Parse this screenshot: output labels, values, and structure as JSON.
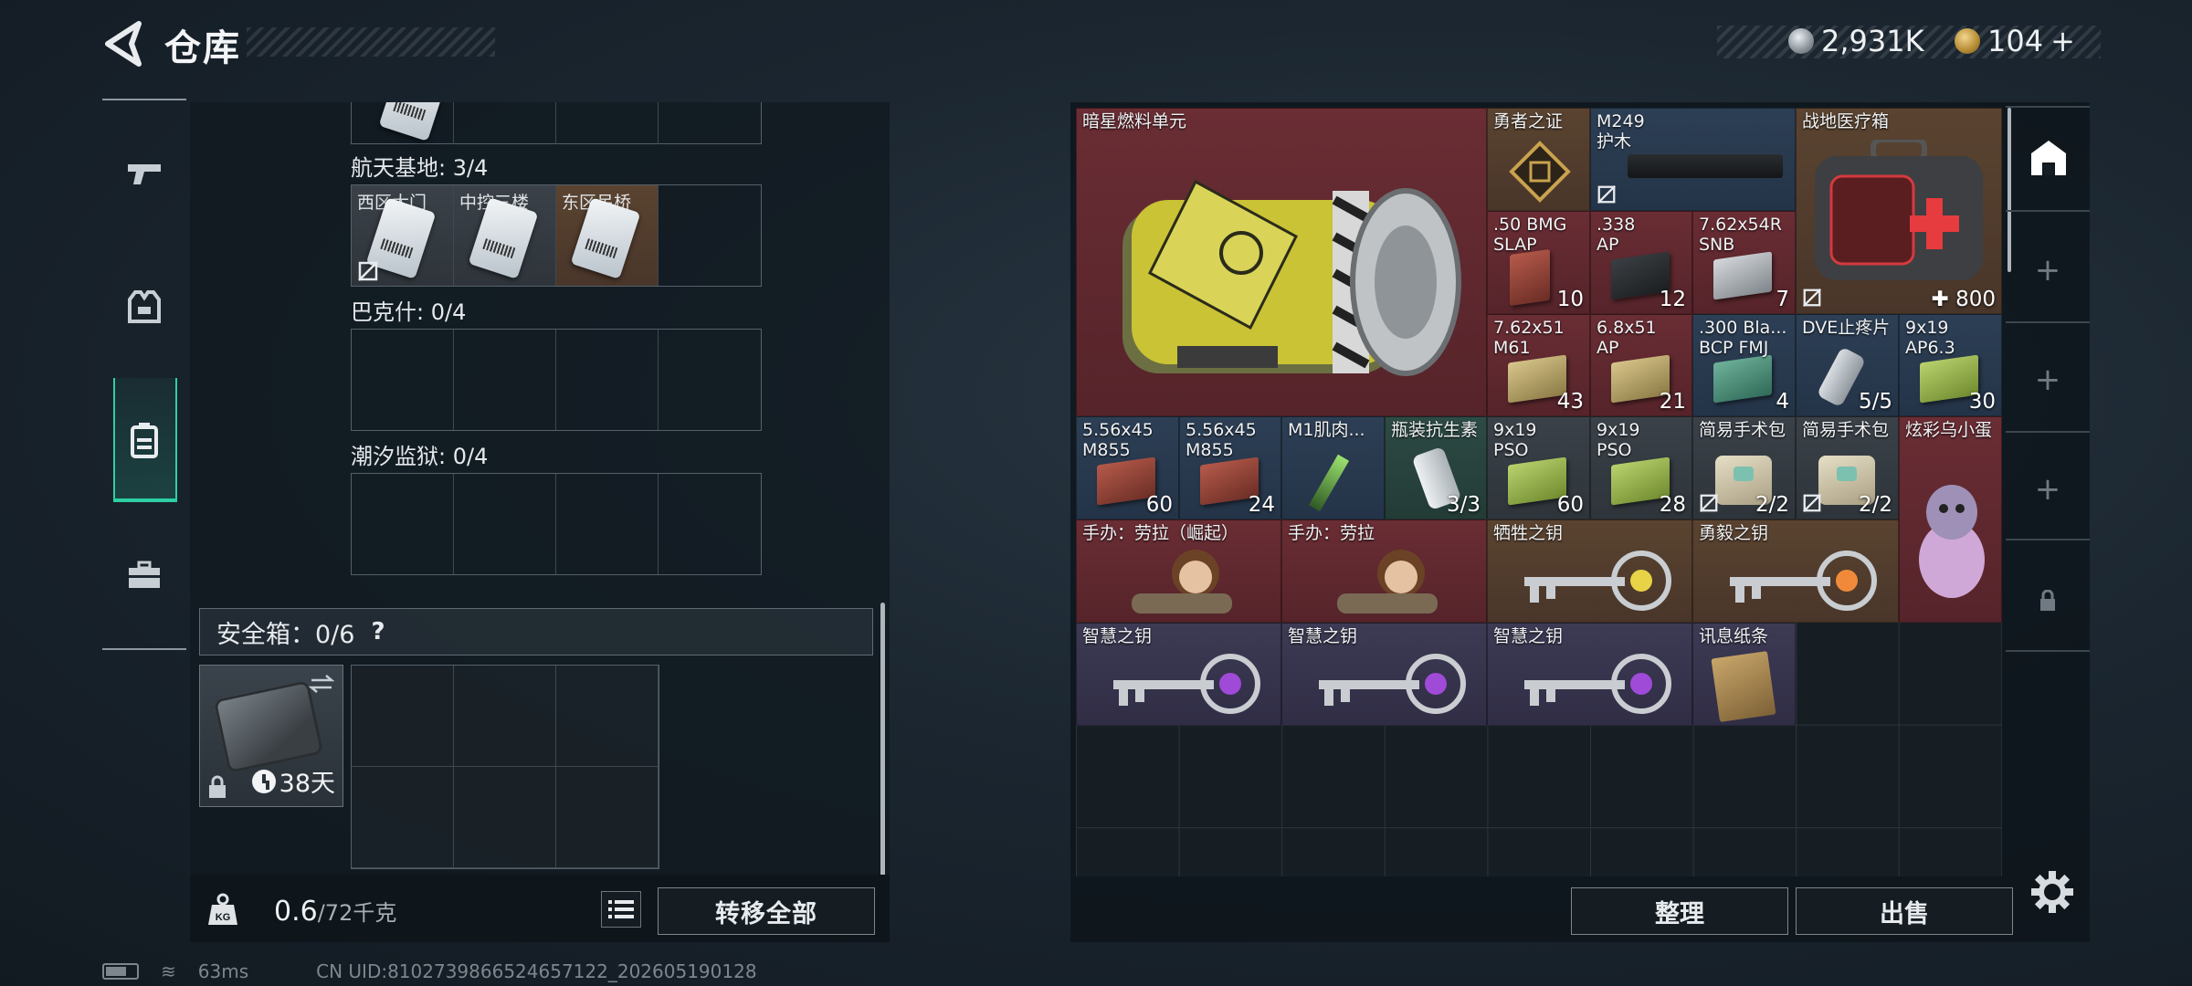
{
  "header": {
    "title": "仓库"
  },
  "currency": [
    {
      "icon": "silver-coin-icon",
      "value": "2,931K"
    },
    {
      "icon": "gold-coin-icon",
      "value": "104",
      "add": "+"
    }
  ],
  "left_nav": [
    {
      "icon": "pistol-icon"
    },
    {
      "icon": "armor-vest-icon"
    },
    {
      "icon": "backpack-icon",
      "active": true
    },
    {
      "icon": "toolbox-icon"
    }
  ],
  "key_sections": [
    {
      "label": "航天基地: 3/4",
      "slots": [
        "西区大门",
        "中控三楼",
        "东区吊桥",
        ""
      ]
    },
    {
      "label": "巴克什: 0/4"
    },
    {
      "label": "潮汐监狱: 0/4"
    }
  ],
  "safebox": {
    "label": "安全箱：0/6",
    "help": "?",
    "days": "38天"
  },
  "weight": {
    "current": "0.6",
    "max": "/72千克"
  },
  "buttons": {
    "transfer_all": "转移全部",
    "sort": "整理",
    "sell": "出售"
  },
  "status": {
    "ping": "63ms",
    "uid": "CN UID:8102739866524657122_202605190128"
  },
  "stash_items": [
    {
      "name": "暗星燃料单元"
    },
    {
      "name": "勇者之证"
    },
    {
      "name": "M249\n护木"
    },
    {
      "name": "战地医疗箱",
      "count": "✚ 800"
    },
    {
      "name": ".50 BMG\nSLAP",
      "count": "10"
    },
    {
      "name": ".338\nAP",
      "count": "12"
    },
    {
      "name": "7.62x54R\nSNB",
      "count": "7"
    },
    {
      "name": "7.62x51\nM61",
      "count": "43"
    },
    {
      "name": "6.8x51\nAP",
      "count": "21"
    },
    {
      "name": ".300 Bla...\nBCP FMJ",
      "count": "4"
    },
    {
      "name": "DVE止疼片",
      "count": "5/5"
    },
    {
      "name": "9x19\nAP6.3",
      "count": "30"
    },
    {
      "name": "5.56x45\nM855",
      "count": "60"
    },
    {
      "name": "5.56x45\nM855",
      "count": "24"
    },
    {
      "name": "M1肌肉..."
    },
    {
      "name": "瓶装抗生素",
      "count": "3/3"
    },
    {
      "name": "9x19\nPSO",
      "count": "60"
    },
    {
      "name": "9x19\nPSO",
      "count": "28"
    },
    {
      "name": "简易手术包",
      "count": "2/2"
    },
    {
      "name": "简易手术包",
      "count": "2/2"
    },
    {
      "name": "炫彩乌小蛋"
    },
    {
      "name": "手办：劳拉（崛起）"
    },
    {
      "name": "手办：劳拉"
    },
    {
      "name": "牺牲之钥"
    },
    {
      "name": "勇毅之钥"
    },
    {
      "name": "智慧之钥"
    },
    {
      "name": "智慧之钥"
    },
    {
      "name": "智慧之钥"
    },
    {
      "name": "讯息纸条"
    }
  ],
  "colors": {
    "accent": "#2dd0a3",
    "rarity_red": "#6a2d34",
    "rarity_blue": "#2d3f55",
    "rarity_gold": "#5a4330",
    "rarity_purple": "#3d3a54"
  }
}
